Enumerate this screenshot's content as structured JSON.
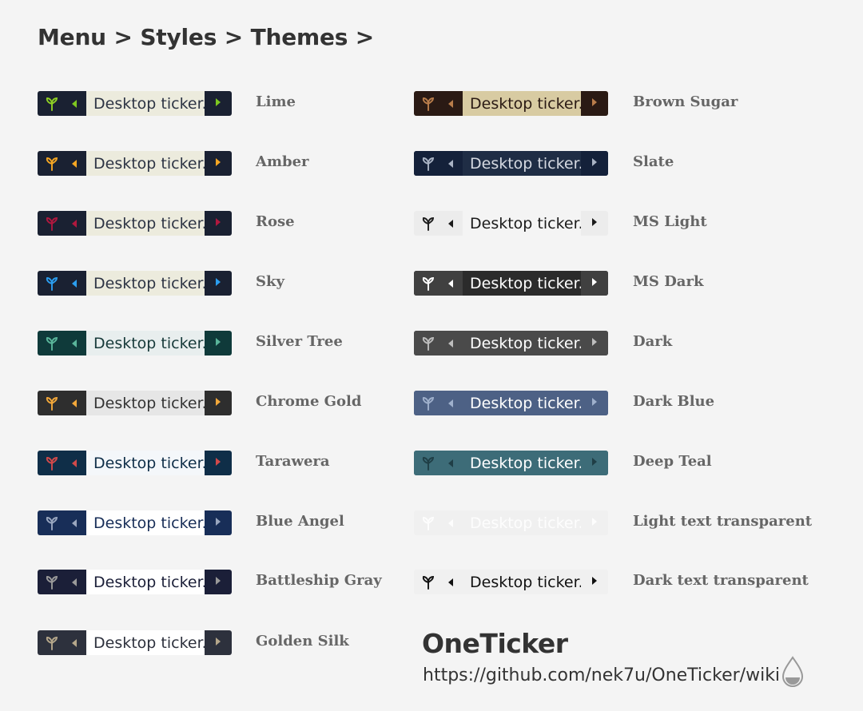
{
  "breadcrumb": [
    "Menu",
    "Styles",
    "Themes"
  ],
  "breadcrumb_separator": ">",
  "ticker_text": "Desktop ticker.",
  "themes": [
    {
      "name": "Lime",
      "col": 0,
      "row": 0,
      "bar": "#1a2132",
      "body": "#ecebdd",
      "text": "#2d3444",
      "icon": "#8fd024",
      "arrow": "#7ec820",
      "tail": "#1a2132"
    },
    {
      "name": "Amber",
      "col": 0,
      "row": 1,
      "bar": "#1a2132",
      "body": "#ecebdd",
      "text": "#2d3444",
      "icon": "#f5a623",
      "arrow": "#f5a623",
      "tail": "#1a2132"
    },
    {
      "name": "Rose",
      "col": 0,
      "row": 2,
      "bar": "#1a2132",
      "body": "#ecebdd",
      "text": "#2d3444",
      "icon": "#b0183e",
      "arrow": "#b0183e",
      "tail": "#1a2132"
    },
    {
      "name": "Sky",
      "col": 0,
      "row": 3,
      "bar": "#1a2132",
      "body": "#ecebdd",
      "text": "#2d3444",
      "icon": "#2b9ef0",
      "arrow": "#2b9ef0",
      "tail": "#1a2132"
    },
    {
      "name": "Silver Tree",
      "col": 0,
      "row": 4,
      "bar": "#0f3a3a",
      "body": "#e8eeee",
      "text": "#173a3a",
      "icon": "#5ab59a",
      "arrow": "#5ab59a",
      "tail": "#0f3a3a"
    },
    {
      "name": "Chrome Gold",
      "col": 0,
      "row": 5,
      "bar": "#2e2e2e",
      "body": "#e6e6e6",
      "text": "#333",
      "icon": "#f3a83a",
      "arrow": "#f3a83a",
      "tail": "#2e2e2e"
    },
    {
      "name": "Tarawera",
      "col": 0,
      "row": 6,
      "bar": "#0f2e48",
      "body": "#f4f7fa",
      "text": "#0f2e48",
      "icon": "#d24a4a",
      "arrow": "#d24a4a",
      "tail": "#0f2e48"
    },
    {
      "name": "Blue Angel",
      "col": 0,
      "row": 7,
      "bar": "#182e58",
      "body": "#ffffff",
      "text": "#182e58",
      "icon": "#9aa7bf",
      "arrow": "#9aa7bf",
      "tail": "#182e58"
    },
    {
      "name": "Battleship Gray",
      "col": 0,
      "row": 8,
      "bar": "#1b1f38",
      "body": "#ffffff",
      "text": "#1b1f38",
      "icon": "#9a9a9a",
      "arrow": "#9a9a9a",
      "tail": "#1b1f38"
    },
    {
      "name": "Golden Silk",
      "col": 0,
      "row": 9,
      "bar": "#2d313d",
      "body": "#ffffff",
      "text": "#2d313d",
      "icon": "#b5a78b",
      "arrow": "#b5a78b",
      "tail": "#2d313d"
    },
    {
      "name": "Brown Sugar",
      "col": 1,
      "row": 0,
      "bar": "#2a1a14",
      "body": "#d8cba2",
      "text": "#2a1a14",
      "icon": "#b97d4b",
      "arrow": "#b97d4b",
      "tail": "#2a1a14"
    },
    {
      "name": "Slate",
      "col": 1,
      "row": 1,
      "bar": "#14213a",
      "body": "#1f2d45",
      "text": "#d6dae2",
      "icon": "#a9b3c4",
      "arrow": "#a9b3c4",
      "tail": "#14213a"
    },
    {
      "name": "MS Light",
      "col": 1,
      "row": 2,
      "bar": "#ececec",
      "body": "#f4f4f4",
      "text": "#1b1b1b",
      "icon": "#1b1b1b",
      "arrow": "#1b1b1b",
      "tail": "#ececec"
    },
    {
      "name": "MS Dark",
      "col": 1,
      "row": 3,
      "bar": "#404040",
      "body": "#2b2b2b",
      "text": "#ffffff",
      "icon": "#ffffff",
      "arrow": "#ffffff",
      "tail": "#404040"
    },
    {
      "name": "Dark",
      "col": 1,
      "row": 4,
      "bar": "#4a4a4a",
      "body": "#4a4a4a",
      "text": "#ffffff",
      "icon": "#bdbdbd",
      "arrow": "#bdbdbd",
      "tail": "#4a4a4a"
    },
    {
      "name": "Dark Blue",
      "col": 1,
      "row": 5,
      "bar": "#4d6185",
      "body": "#4d6185",
      "text": "#ffffff",
      "icon": "#9fb0cc",
      "arrow": "#9fb0cc",
      "tail": "#4d6185"
    },
    {
      "name": "Deep Teal",
      "col": 1,
      "row": 6,
      "bar": "#3d6c78",
      "body": "#3d6c78",
      "text": "#ffffff",
      "icon": "#1f3e46",
      "arrow": "#1f3e46",
      "tail": "#3d6c78"
    },
    {
      "name": "Light text  transparent",
      "col": 1,
      "row": 7,
      "bar": "#f0f0f0",
      "body": "#f0f0f0",
      "text": "#ffffff",
      "icon": "#ffffff",
      "arrow": "#ffffff",
      "tail": "#f0f0f0"
    },
    {
      "name": "Dark text  transparent",
      "col": 1,
      "row": 8,
      "bar": "#f0f0f0",
      "body": "#f0f0f0",
      "text": "#111111",
      "icon": "#111111",
      "arrow": "#111111",
      "tail": "#f0f0f0"
    }
  ],
  "brand": "OneTicker",
  "url": "https://github.com/nek7u/OneTicker/wiki",
  "icons": {
    "sprout": "sprout-icon",
    "prev": "triangle-left-icon",
    "next": "triangle-right-icon",
    "drop": "water-drop-icon"
  }
}
